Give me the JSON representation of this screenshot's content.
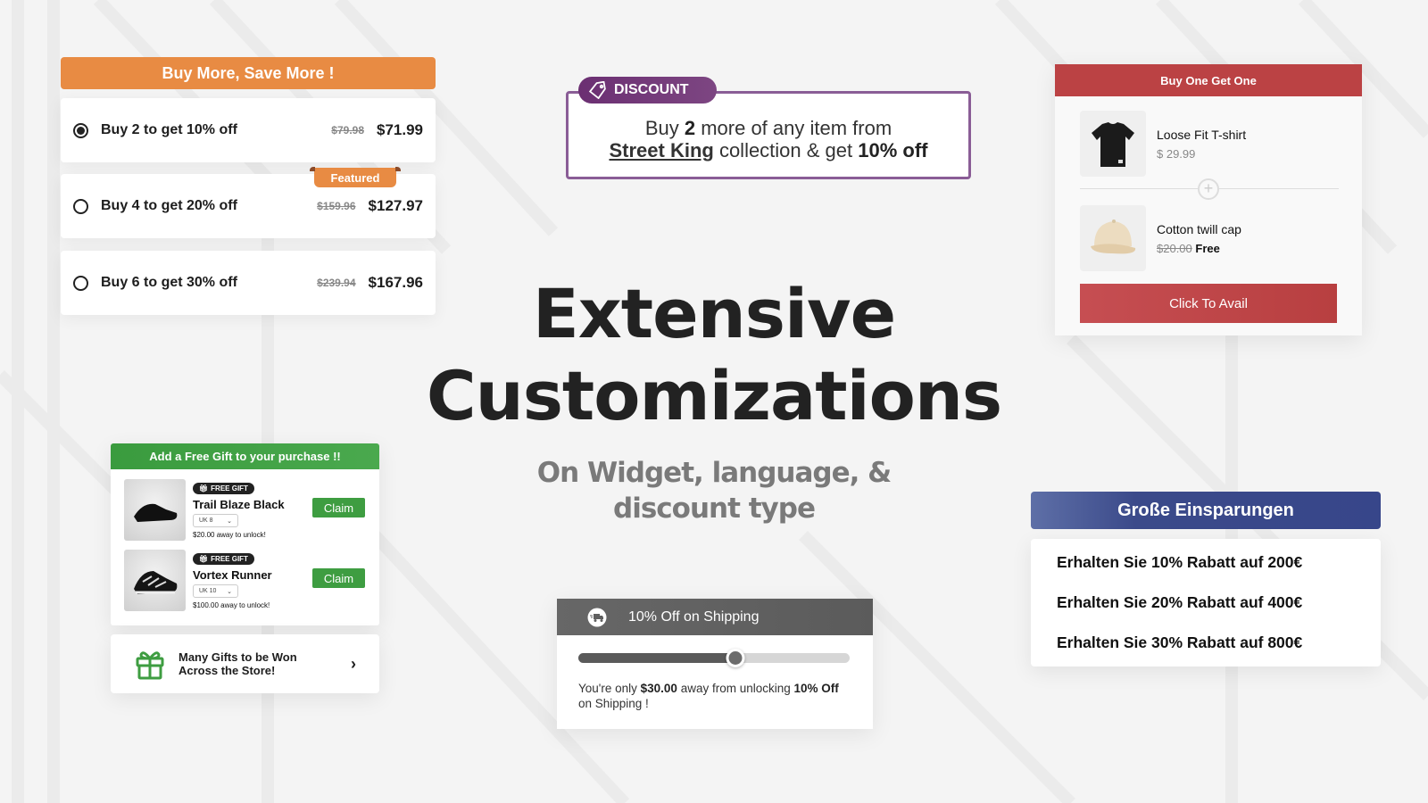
{
  "buy_more_save_more": {
    "header": "Buy More, Save More !",
    "featured_label": "Featured",
    "options": [
      {
        "label": "Buy 2 to get 10% off",
        "old_price": "$79.98",
        "new_price": "$71.99",
        "selected": true
      },
      {
        "label": "Buy 4 to get 20% off",
        "old_price": "$159.96",
        "new_price": "$127.97",
        "selected": false
      },
      {
        "label": "Buy 6 to get 30% off",
        "old_price": "$239.94",
        "new_price": "$167.96",
        "selected": false
      }
    ],
    "accent": "#e88b43"
  },
  "discount_banner": {
    "tag": "DISCOUNT",
    "icon": "tag-icon",
    "line1_pre": "Buy ",
    "line1_qty": "2",
    "line1_post": " more of any item from",
    "collection": "Street King",
    "line2_mid": " collection & get ",
    "line2_offer": "10% off",
    "accent": "#7b3f82"
  },
  "bogo": {
    "header": "Buy One Get One",
    "items": [
      {
        "name": "Loose Fit T-shirt",
        "price": "$ 29.99"
      },
      {
        "name": "Cotton twill cap",
        "old_price": "$20.00",
        "price": "Free"
      }
    ],
    "button": "Click To Avail",
    "accent": "#bb4244"
  },
  "hero": {
    "title_line1": "Extensive",
    "title_line2": "Customizations",
    "subtitle_line1": "On Widget, language, &",
    "subtitle_line2": "discount type"
  },
  "free_gift": {
    "header": "Add a Free Gift to your purchase !!",
    "badge": "FREE GIFT",
    "items": [
      {
        "name": "Trail Blaze Black",
        "size": "UK 8",
        "away": "$20.00 away to unlock!",
        "button": "Claim"
      },
      {
        "name": "Vortex Runner",
        "size": "UK 10",
        "away": "$100.00 away to unlock!",
        "button": "Claim"
      }
    ],
    "banner_line1": "Many Gifts to be Won",
    "banner_line2": "Across the Store!",
    "accent": "#3e9d41"
  },
  "shipping": {
    "header": "10% Off on Shipping",
    "progress": 0.58,
    "text_pre": "You're only ",
    "amount": "$30.00",
    "text_mid": " away from unlocking ",
    "offer": "10% Off",
    "text_post": " on Shipping !"
  },
  "german": {
    "header": "Große Einsparungen",
    "lines": [
      "Erhalten Sie 10% Rabatt auf 200€",
      "Erhalten Sie 20% Rabatt auf 400€",
      "Erhalten Sie 30% Rabatt auf 800€"
    ],
    "accent": "#3b4a8a"
  }
}
